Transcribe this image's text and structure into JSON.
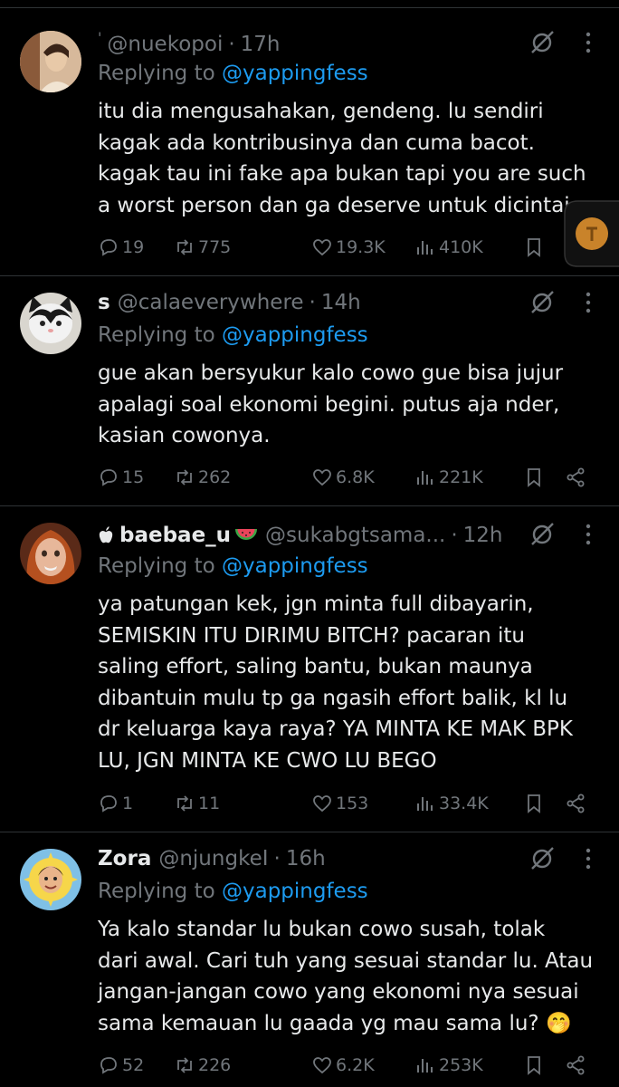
{
  "replying_prefix": "Replying to ",
  "tweets": [
    {
      "display_name": "",
      "display_mark": "'",
      "handle": "@nuekopoi",
      "time": "17h",
      "replying_to": "@yappingfess",
      "lines": [
        "itu dia mengusahakan, gendeng. lu sendiri",
        "kagak ada kontribusinya dan cuma bacot.",
        "kagak tau ini fake apa bukan tapi you are such",
        "a worst person dan ga deserve untuk dicintai"
      ],
      "replies": "19",
      "reposts": "775",
      "likes": "19.3K",
      "views": "410K",
      "avatar": "portrait-photo"
    },
    {
      "display_name": "s",
      "handle": "@calaeverywhere",
      "time": "14h",
      "replying_to": "@yappingfess",
      "lines": [
        "gue akan bersyukur kalo cowo gue bisa jujur",
        "apalagi soal ekonomi begini. putus aja nder,",
        "kasian cowonya."
      ],
      "replies": "15",
      "reposts": "262",
      "likes": "6.8K",
      "views": "221K",
      "avatar": "cat-photo"
    },
    {
      "display_name": "baebae_u",
      "name_prefix_icon": "apple-icon",
      "name_suffix_icon": "watermelon-emoji",
      "handle": "@sukabgtsama...",
      "time": "12h",
      "replying_to": "@yappingfess",
      "lines": [
        "ya patungan kek, jgn minta full dibayarin,",
        "SEMISKIN ITU DIRIMU BITCH? pacaran itu",
        "saling effort, saling bantu, bukan maunya",
        "dibantuin mulu tp ga ngasih effort balik, kl lu",
        "dr keluarga kaya raya? YA MINTA KE MAK BPK",
        "LU, JGN MINTA KE CWO LU BEGO"
      ],
      "replies": "1",
      "reposts": "11",
      "likes": "153",
      "views": "33.4K",
      "avatar": "doll-face"
    },
    {
      "display_name": "Zora",
      "handle": "@njungkeI",
      "time": "16h",
      "replying_to": "@yappingfess",
      "lines": [
        "Ya kalo standar lu bukan cowo susah, tolak",
        "dari awal. Cari tuh yang sesuai standar lu. Atau",
        "jangan-jangan cowo yang ekonomi nya sesuai",
        "sama kemauan lu gaada yg mau sama lu? 🤭"
      ],
      "replies": "52",
      "reposts": "226",
      "likes": "6.2K",
      "views": "253K",
      "avatar": "sun-face"
    }
  ]
}
